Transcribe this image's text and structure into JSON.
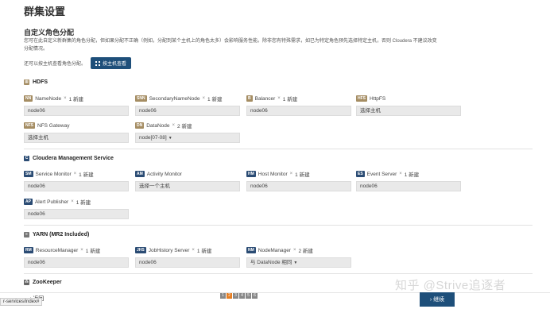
{
  "page_title": "群集设置",
  "section_title": "自定义角色分配",
  "description": "您可在此自定义新群集的角色分配，但如果分配不正确（例如，分配到某个主机上的角色太多）会影响服务性能。除非您有特殊需求，如已为特定角色预先选择特定主机，否则 Cloudera 不建议改变分配情况。",
  "hostview": {
    "text": "还可以按主机查看角色分配。",
    "button_label": "按主机查看"
  },
  "services": {
    "hdfs": {
      "name": "HDFS",
      "roles": [
        {
          "badge": "NN",
          "name": "NameNode",
          "times": "×",
          "count": "1 新建",
          "value": "node06"
        },
        {
          "badge": "SNN",
          "name": "SecondaryNameNode",
          "times": "×",
          "count": "1 新建",
          "value": "node06"
        },
        {
          "badge": "B",
          "name": "Balancer",
          "times": "×",
          "count": "1 新建",
          "value": "node06"
        },
        {
          "badge": "HFS",
          "name": "HttpFS",
          "times": "",
          "count": "",
          "value": "选择主机"
        },
        {
          "badge": "NFS",
          "name": "NFS Gateway",
          "times": "",
          "count": "",
          "value": "选择主机"
        },
        {
          "badge": "DN",
          "name": "DataNode",
          "times": "×",
          "count": "2 新建",
          "value": "node[07-08]",
          "dropdown": "▼"
        }
      ]
    },
    "cm": {
      "name": "Cloudera Management Service",
      "roles": [
        {
          "badge": "SM",
          "name": "Service Monitor",
          "times": "×",
          "count": "1 新建",
          "value": "node06"
        },
        {
          "badge": "AM",
          "name": "Activity Monitor",
          "times": "",
          "count": "",
          "value": "选择一个主机"
        },
        {
          "badge": "HM",
          "name": "Host Monitor",
          "times": "×",
          "count": "1 新建",
          "value": "node06"
        },
        {
          "badge": "ES",
          "name": "Event Server",
          "times": "×",
          "count": "1 新建",
          "value": "node06"
        },
        {
          "badge": "AP",
          "name": "Alert Publisher",
          "times": "×",
          "count": "1 新建",
          "value": "node06"
        }
      ]
    },
    "yarn": {
      "name": "YARN (MR2 Included)",
      "roles": [
        {
          "badge": "RM",
          "name": "ResourceManager",
          "times": "×",
          "count": "1 新建",
          "value": "node06"
        },
        {
          "badge": "JHS",
          "name": "JobHistory Server",
          "times": "×",
          "count": "1 新建",
          "value": "node06"
        },
        {
          "badge": "NM",
          "name": "NodeManager",
          "times": "×",
          "count": "2 新建",
          "value": "与 DataNode 相同",
          "dropdown": "▼"
        }
      ]
    },
    "zookeeper": {
      "name": "ZooKeeper"
    }
  },
  "footer": {
    "url_tip": "r-services/index#",
    "back_label": "返回",
    "back_icon": "chevron-left-icon",
    "pages": [
      "1",
      "2",
      "3",
      "4",
      "5",
      "6"
    ],
    "active_page_index": 1,
    "continue_label": "继续",
    "continue_icon": "chevron-right-icon"
  },
  "watermark": "知乎 @Strive追逐者",
  "colors": {
    "primary": "#1e4f7a",
    "hdfs_badge": "#a58d63",
    "cm_badge": "#2b4c74",
    "active_page": "#e67e22"
  }
}
